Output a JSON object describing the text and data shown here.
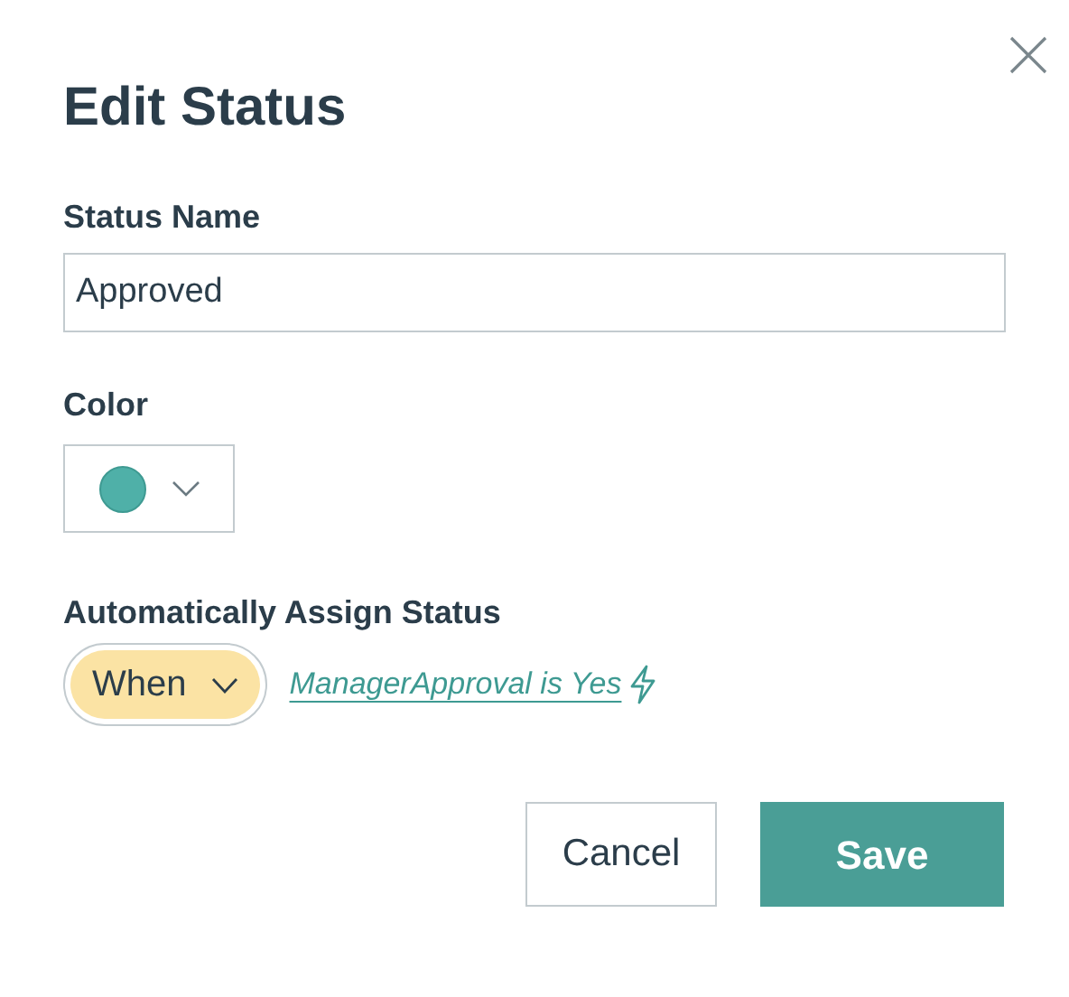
{
  "dialog": {
    "title": "Edit Status"
  },
  "status_name": {
    "label": "Status Name",
    "value": "Approved"
  },
  "color": {
    "label": "Color",
    "color": "#4fb0a8"
  },
  "auto_assign": {
    "label": "Automatically Assign Status",
    "trigger": "When",
    "condition": "ManagerApproval is Yes"
  },
  "buttons": [
    {
      "label": "Cancel",
      "kind": "secondary"
    },
    {
      "label": "Save",
      "kind": "primary"
    }
  ]
}
